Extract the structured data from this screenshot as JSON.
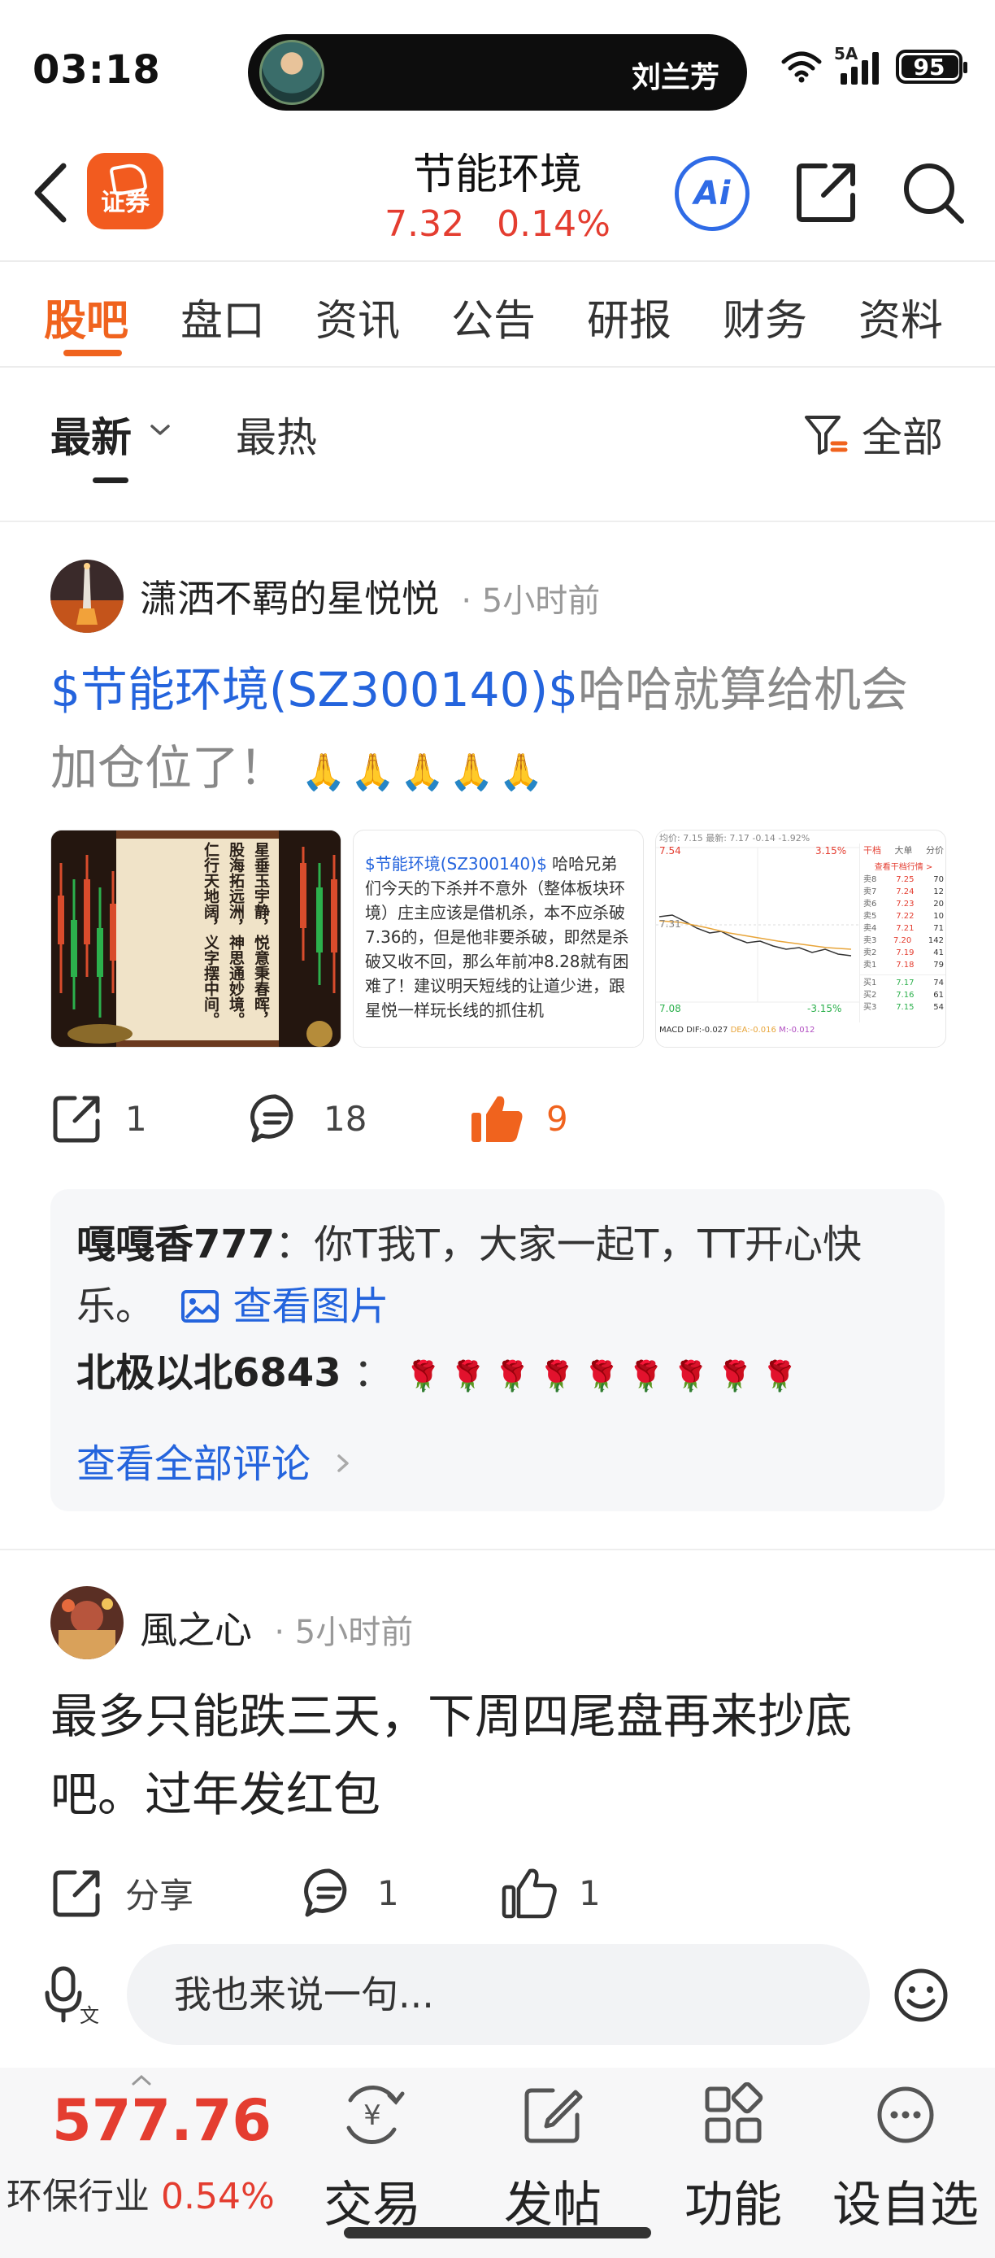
{
  "status_bar": {
    "time": "03:18",
    "caller_name": "刘兰芳",
    "network": "5A",
    "battery": "95"
  },
  "header": {
    "app_badge": "证券",
    "stock_name": "节能环境",
    "price": "7.32",
    "change_pct": "0.14%",
    "ai_label": "Ai"
  },
  "tabs": [
    "股吧",
    "盘口",
    "资讯",
    "公告",
    "研报",
    "财务",
    "资料"
  ],
  "sort": {
    "latest": "最新",
    "hot": "最热",
    "filter": "全部"
  },
  "posts": [
    {
      "author": "潇洒不羁的星悦悦",
      "time": "5小时前",
      "stock_tag": "$节能环境(SZ300140)$",
      "text": "哈哈就算给机会加仓位了！",
      "emoji": "🙏🙏🙏🙏🙏",
      "thumbnails": {
        "poem": [
          "星垂玉宇静，悦意秉春晖，",
          "股海拓远洲，神思通妙境。",
          "仁行天地阔，义字摆中间。"
        ],
        "note_tag": "$节能环境(SZ300140)$",
        "note_text": "哈哈兄弟们今天的下杀并不意外（整体板块环境）庄主应该是借机杀，本不应杀破7.36的，但是他非要杀破，即然是杀破又收不回，那么年前冲8.28就有困难了！建议明天短线的让道少进，跟星悦一样玩长线的抓住机",
        "chart_header": "均价: 7.15  最新: 7.17  -0.14  -1.92%",
        "chart_high": "7.54",
        "chart_mid": "7.31",
        "chart_low": "7.08",
        "chart_up_pct": "3.15%",
        "chart_down_pct": "-3.15%",
        "chart_tabs": [
          "干档",
          "大单",
          "分价"
        ],
        "chart_link": "查看干档行情 >",
        "chart_indicators": [
          "MACD",
          "DIF:-0.027",
          "DEA:-0.016",
          "M:-0.012"
        ],
        "order_book": [
          [
            "卖8",
            "7.25",
            "70"
          ],
          [
            "卖7",
            "7.24",
            "12"
          ],
          [
            "卖6",
            "7.23",
            "20"
          ],
          [
            "卖5",
            "7.22",
            "10"
          ],
          [
            "卖4",
            "7.21",
            "71"
          ],
          [
            "卖3",
            "7.20",
            "142"
          ],
          [
            "卖2",
            "7.19",
            "41"
          ],
          [
            "卖1",
            "7.18",
            "79"
          ],
          [
            "买1",
            "7.17",
            "74"
          ],
          [
            "买2",
            "7.16",
            "61"
          ],
          [
            "买3",
            "7.15",
            "54"
          ]
        ]
      },
      "shares": "1",
      "comments": "18",
      "likes": "9",
      "comment_preview": [
        {
          "author": "嘎嘎香777",
          "text": "：你T我T，大家一起T，TT开心快乐。",
          "view_image": "查看图片"
        },
        {
          "author": "北极以北6843",
          "text": "：",
          "emoji": "🌹🌹🌹🌹🌹🌹🌹🌹🌹"
        }
      ],
      "view_all": "查看全部评论"
    },
    {
      "author": "風之心",
      "time": "5小时前",
      "text": "最多只能跌三天，下周四尾盘再来抄底吧。过年发红包",
      "share_label": "分享",
      "comments": "1",
      "likes": "1"
    }
  ],
  "input": {
    "placeholder": "我也来说一句..."
  },
  "toolbar": {
    "sector_price": "577.76",
    "sector_name": "环保行业",
    "sector_change": "0.54%",
    "items": [
      "交易",
      "发帖",
      "功能",
      "设自选"
    ]
  },
  "colors": {
    "accent": "#f0631e",
    "up_red": "#e43d30",
    "link_blue": "#2464dd"
  }
}
